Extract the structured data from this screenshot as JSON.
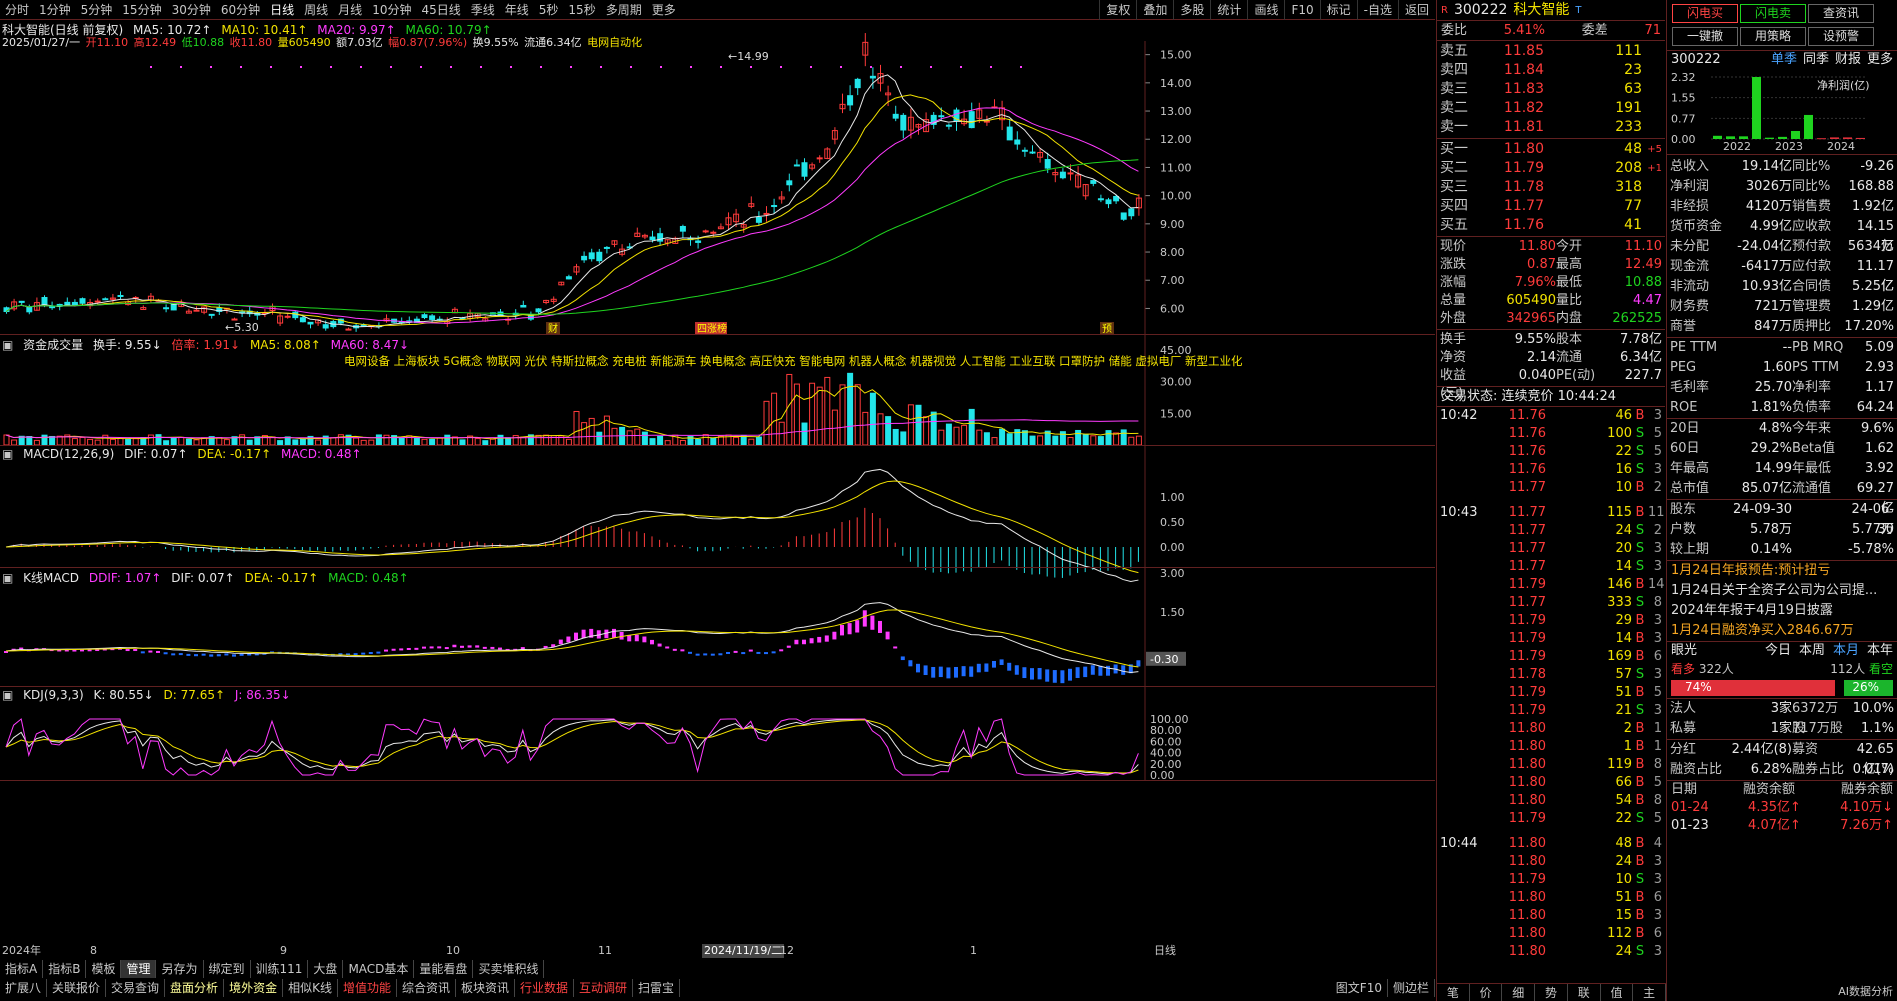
{
  "topbar": {
    "periods": [
      "分时",
      "1分钟",
      "5分钟",
      "15分钟",
      "30分钟",
      "60分钟",
      "日线",
      "周线",
      "月线",
      "10分钟",
      "45日线",
      "季线",
      "年线",
      "5秒",
      "15秒",
      "多周期",
      "更多"
    ],
    "active": "日线",
    "tools": [
      "复权",
      "叠加",
      "多股",
      "统计",
      "画线",
      "F10",
      "标记",
      "-自选",
      "返回"
    ]
  },
  "main": {
    "title": "科大智能(日线 前复权)",
    "ma5": "MA5: 10.72↑",
    "ma10": "MA10: 10.41↑",
    "ma20": "MA20: 9.97↑",
    "ma60": "MA60: 10.79↑",
    "info_date": "2025/01/27/一",
    "info_open": "开11.10",
    "info_high": "高12.49",
    "info_low": "低10.88",
    "info_close": "收11.80",
    "info_vol": "量605490",
    "info_amt": "额7.03亿",
    "info_chg": "幅0.87(7.96%)",
    "info_turn": "换9.55%",
    "info_float": "流通6.34亿",
    "info_concept": "电网自动化",
    "yaxis": [
      "15.00",
      "14.00",
      "13.00",
      "12.00",
      "11.00",
      "10.00",
      "9.00",
      "8.00",
      "7.00",
      "6.00"
    ],
    "hi_label": "14.99",
    "lo_label": "5.30",
    "marks": [
      "财",
      "四涨榜",
      "预"
    ]
  },
  "vol": {
    "title": "资金成交量",
    "turn": "换手: 9.55↓",
    "ratio": "倍率: 1.91↓",
    "ma5": "MA5: 8.08↑",
    "ma60": "MA60: 8.47↓",
    "concepts": "电网设备 上海板块 5G概念 物联网 光伏 特斯拉概念 充电桩 新能源车 换电概念 高压快充 智能电网 机器人概念 机器视觉 人工智能 工业互联 口罩防护 储能 虚拟电厂 新型工业化",
    "yaxis": [
      "45.00",
      "30.00",
      "15.00"
    ]
  },
  "macd": {
    "title": "MACD(12,26,9)",
    "dif": "DIF: 0.07↑",
    "dea": "DEA: -0.17↑",
    "macd": "MACD: 0.48↑",
    "yaxis": [
      "1.00",
      "0.50",
      "0.00"
    ]
  },
  "kmacd": {
    "title": "K线MACD",
    "ddif": "DDIF: 1.07↑",
    "dif": "DIF: 0.07↑",
    "dea": "DEA: -0.17↑",
    "macd": "MACD: 0.48↑",
    "yaxis": [
      "3.00",
      "1.50"
    ],
    "cursor": "-0.30"
  },
  "kdj": {
    "title": "KDJ(9,3,3)",
    "k": "K: 80.55↓",
    "d": "D: 77.65↑",
    "j": "J: 86.35↓",
    "yaxis": [
      "100.00",
      "80.00",
      "60.00",
      "40.00",
      "20.00",
      "0.00"
    ]
  },
  "xaxis": {
    "labels": [
      "2024年",
      "8",
      "9",
      "10",
      "11",
      "2024/11/19/二",
      "12",
      "1"
    ],
    "right": "日线"
  },
  "bottom": {
    "row1": [
      "指标A",
      "指标B",
      "模板",
      "管理",
      "另存为",
      "绑定到",
      "训练111",
      "大盘",
      "MACD基本",
      "量能看盘",
      "买卖堆积线"
    ],
    "row2": [
      "扩展八",
      "关联报价",
      "交易查询",
      "盘面分析",
      "境外资金",
      "相似K线",
      "增值功能",
      "综合资讯",
      "板块资讯",
      "行业数据",
      "互动调研",
      "扫雷宝"
    ],
    "right": [
      "图文F10",
      "侧边栏"
    ]
  },
  "quote": {
    "code": "300222",
    "name": "科大智能",
    "webi_label": "委比",
    "webi": "5.41%",
    "wecha_label": "委差",
    "wecha": "71",
    "asks": [
      {
        "l": "卖五",
        "p": "11.85",
        "v": "111"
      },
      {
        "l": "卖四",
        "p": "11.84",
        "v": "23"
      },
      {
        "l": "卖三",
        "p": "11.83",
        "v": "63"
      },
      {
        "l": "卖二",
        "p": "11.82",
        "v": "191"
      },
      {
        "l": "卖一",
        "p": "11.81",
        "v": "233"
      }
    ],
    "bids": [
      {
        "l": "买一",
        "p": "11.80",
        "v": "48",
        "c": "+5"
      },
      {
        "l": "买二",
        "p": "11.79",
        "v": "208",
        "c": "+1"
      },
      {
        "l": "买三",
        "p": "11.78",
        "v": "318",
        "c": ""
      },
      {
        "l": "买四",
        "p": "11.77",
        "v": "77",
        "c": ""
      },
      {
        "l": "买五",
        "p": "11.76",
        "v": "41",
        "c": ""
      }
    ],
    "stats": [
      [
        "现价",
        "11.80",
        "今开",
        "11.10"
      ],
      [
        "涨跌",
        "0.87",
        "最高",
        "12.49"
      ],
      [
        "涨幅",
        "7.96%",
        "最低",
        "10.88"
      ],
      [
        "总量",
        "605490",
        "量比",
        "4.47"
      ],
      [
        "外盘",
        "342965",
        "内盘",
        "262525"
      ]
    ],
    "stats2": [
      [
        "换手",
        "9.55%",
        "股本",
        "7.78亿"
      ],
      [
        "净资",
        "2.14",
        "流通",
        "6.34亿"
      ],
      [
        "收益(三)",
        "0.040",
        "PE(动)",
        "227.7"
      ]
    ],
    "status": "交易状态: 连续竞价 10:44:24",
    "ticks": [
      [
        "10:42",
        "11.76",
        "46",
        "B",
        "3"
      ],
      [
        "",
        "11.76",
        "100",
        "S",
        "5"
      ],
      [
        "",
        "11.76",
        "22",
        "S",
        "5"
      ],
      [
        "",
        "11.76",
        "16",
        "S",
        "3"
      ],
      [
        "",
        "11.77",
        "10",
        "B",
        "2"
      ],
      [
        "10:43",
        "11.77",
        "115",
        "B",
        "11"
      ],
      [
        "",
        "11.77",
        "24",
        "S",
        "2"
      ],
      [
        "",
        "11.77",
        "20",
        "S",
        "3"
      ],
      [
        "",
        "11.77",
        "14",
        "S",
        "3"
      ],
      [
        "",
        "11.79",
        "146",
        "B",
        "14"
      ],
      [
        "",
        "11.77",
        "333",
        "S",
        "8"
      ],
      [
        "",
        "11.79",
        "29",
        "B",
        "3"
      ],
      [
        "",
        "11.79",
        "14",
        "B",
        "3"
      ],
      [
        "",
        "11.79",
        "169",
        "B",
        "6"
      ],
      [
        "",
        "11.78",
        "57",
        "S",
        "3"
      ],
      [
        "",
        "11.79",
        "51",
        "B",
        "5"
      ],
      [
        "",
        "11.79",
        "21",
        "S",
        "3"
      ],
      [
        "",
        "11.80",
        "2",
        "B",
        "1"
      ],
      [
        "",
        "11.80",
        "1",
        "B",
        "1"
      ],
      [
        "",
        "11.80",
        "119",
        "B",
        "8"
      ],
      [
        "",
        "11.80",
        "66",
        "B",
        "5"
      ],
      [
        "",
        "11.80",
        "54",
        "B",
        "8"
      ],
      [
        "",
        "11.79",
        "22",
        "S",
        "5"
      ],
      [
        "10:44",
        "11.80",
        "48",
        "B",
        "4"
      ],
      [
        "",
        "11.80",
        "24",
        "B",
        "3"
      ],
      [
        "",
        "11.79",
        "10",
        "S",
        "3"
      ],
      [
        "",
        "11.80",
        "51",
        "B",
        "6"
      ],
      [
        "",
        "11.80",
        "15",
        "B",
        "3"
      ],
      [
        "",
        "11.80",
        "112",
        "B",
        "6"
      ],
      [
        "",
        "11.80",
        "24",
        "S",
        "3"
      ]
    ],
    "bottom_tabs": [
      "笔",
      "价",
      "细",
      "势",
      "联",
      "值",
      "主"
    ]
  },
  "far": {
    "btns": [
      "闪电买",
      "闪电卖",
      "查资讯",
      "一键撤",
      "用策略",
      "设预警"
    ],
    "code": "300222",
    "tabs": [
      "单季",
      "同季",
      "财报",
      "更多"
    ],
    "chart_label": "净利润(亿)",
    "chart_y": [
      "2.32",
      "1.55",
      "0.77",
      "0.00"
    ],
    "chart_x": [
      "2022",
      "2023",
      "2024"
    ],
    "chart_data": {
      "type": "bar",
      "values": [
        0.12,
        0.1,
        0.1,
        2.32,
        0.05,
        0.08,
        0.3,
        0.9,
        0.03,
        0.06,
        0.06,
        0.04
      ]
    },
    "fin": [
      [
        "总收入",
        "19.14亿",
        "同比%",
        "-9.26"
      ],
      [
        "净利润",
        "3026万",
        "同比%",
        "168.88"
      ],
      [
        "非经损",
        "4120万",
        "销售费",
        "1.92亿"
      ],
      [
        "货币资金",
        "4.99亿",
        "应收款",
        "14.15亿"
      ],
      [
        "未分配",
        "-24.04亿",
        "预付款",
        "5634万"
      ],
      [
        "现金流",
        "-6417万",
        "应付款",
        "11.17亿"
      ],
      [
        "非流动",
        "10.93亿",
        "合同债",
        "5.25亿"
      ],
      [
        "财务费",
        "721万",
        "管理费",
        "1.29亿"
      ],
      [
        "商誉",
        "847万",
        "质押比",
        "17.20%"
      ]
    ],
    "val": [
      [
        "PE TTM",
        "--",
        "PB MRQ",
        "5.09"
      ],
      [
        "PEG",
        "1.60",
        "PS TTM",
        "2.93"
      ],
      [
        "毛利率",
        "25.70",
        "净利率",
        "1.17"
      ],
      [
        "ROE",
        "1.81%",
        "负债率",
        "64.24"
      ]
    ],
    "perf": [
      [
        "20日",
        "4.8%",
        "今年来",
        "9.6%"
      ],
      [
        "60日",
        "29.2%",
        "Beta值",
        "1.62"
      ],
      [
        "年最高",
        "14.99",
        "年最低",
        "3.92"
      ],
      [
        "总市值",
        "85.07亿",
        "流通值",
        "69.27亿"
      ]
    ],
    "holder": [
      [
        "股东",
        "24-09-30",
        "",
        "24-06-30"
      ],
      [
        "户数",
        "5.78万",
        "",
        "5.77万"
      ],
      [
        "较上期",
        "0.14%",
        "",
        "-5.78%"
      ]
    ],
    "news": [
      "1月24日年报预告:预计扭亏",
      "1月24日关于全资子公司为公司提...",
      "2024年年报于4月19日披露",
      "1月24日融资净买入2846.67万"
    ],
    "sent": {
      "label": "眼光",
      "tabs": [
        "今日",
        "本周",
        "本月",
        "本年"
      ],
      "bull": "看多",
      "bull_n": "322人",
      "bear": "看空",
      "bear_n": "112人",
      "bull_pct": "74%",
      "bear_pct": "26%",
      "bull_frac": 0.74
    },
    "inst": [
      [
        "法人",
        "3家",
        "6372万股",
        "10.0%"
      ],
      [
        "私募",
        "1家",
        "717万股",
        "1.1%"
      ]
    ],
    "margin": [
      [
        "分红",
        "2.44亿(8)",
        "募资",
        "42.65亿(7)"
      ],
      [
        "融资占比",
        "6.28%",
        "融券占比",
        "0.01%"
      ]
    ],
    "mhead": [
      "日期",
      "融资余额",
      "融券余额"
    ],
    "mrows": [
      [
        "01-24",
        "4.35亿↑",
        "4.10万↓"
      ],
      [
        "01-23",
        "4.07亿↑",
        "7.26万↑"
      ]
    ],
    "bottom": "AI数据分析"
  }
}
